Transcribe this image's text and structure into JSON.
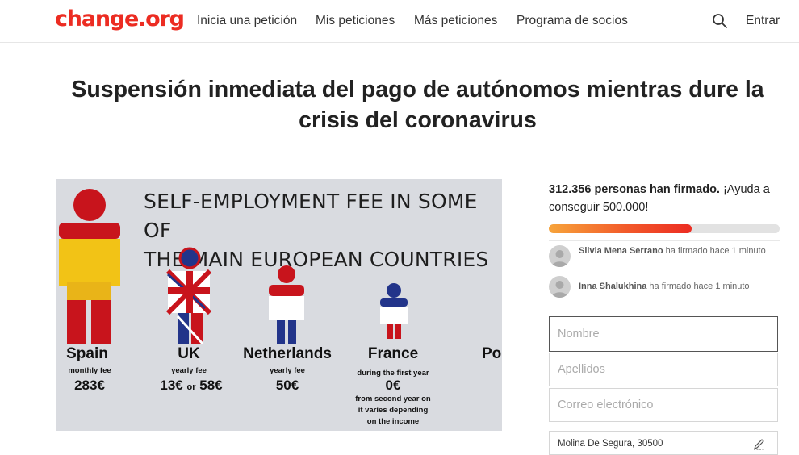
{
  "header": {
    "logo": "change.org",
    "nav": [
      {
        "label": "Inicia una petición"
      },
      {
        "label": "Mis peticiones"
      },
      {
        "label": "Más peticiones"
      },
      {
        "label": "Programa de socios"
      }
    ],
    "search_icon": "search-icon",
    "login_label": "Entrar"
  },
  "petition": {
    "title_line1": "Suspensión inmediata del pago de autónomos mientras dure la",
    "title_line2": "crisis del coronavirus"
  },
  "infographic": {
    "title_line1": "SELF-EMPLOYMENT FEE IN SOME OF",
    "title_line2": "THE MAIN EUROPEAN COUNTRIES",
    "countries": [
      {
        "name": "Spain",
        "period": "monthly fee",
        "fee": "283€"
      },
      {
        "name": "UK",
        "period": "yearly fee",
        "fee_a": "13€",
        "fee_or": "or",
        "fee_b": "58€"
      },
      {
        "name": "Netherlands",
        "period": "yearly fee",
        "fee": "50€"
      },
      {
        "name": "France",
        "period": "during the first year",
        "fee": "0€",
        "note_line1": "from second year on",
        "note_line2": "it varies depending",
        "note_line3": "on the income"
      },
      {
        "name": "Po"
      }
    ]
  },
  "sidebar": {
    "count_bold": "312.356 personas han firmado.",
    "count_rest": " ¡Ayuda a conseguir 500.000!",
    "progress_fraction": 0.62,
    "signers": [
      {
        "name": "Silvia Mena Serrano",
        "action": " ha firmado hace 1 minuto"
      },
      {
        "name": "Inna Shalukhina",
        "action": " ha firmado hace 1 minuto"
      }
    ],
    "form": {
      "first_name_placeholder": "Nombre",
      "last_name_placeholder": "Apellidos",
      "email_placeholder": "Correo electrónico",
      "location": "Molina De Segura, 30500"
    }
  },
  "colors": {
    "brand": "#ec2c22",
    "progress_start": "#f7a43a",
    "progress_end": "#ec2c22"
  }
}
